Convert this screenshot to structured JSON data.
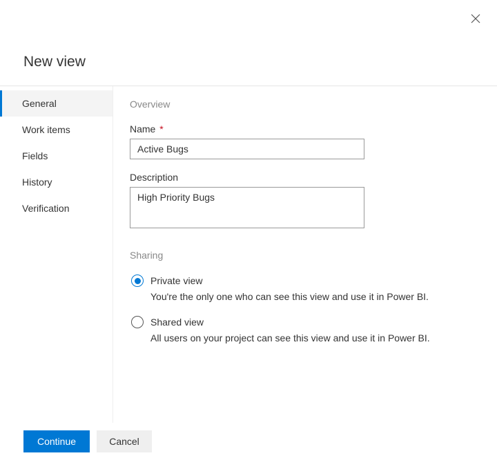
{
  "dialog": {
    "title": "New view"
  },
  "sidebar": {
    "items": [
      {
        "label": "General"
      },
      {
        "label": "Work items"
      },
      {
        "label": "Fields"
      },
      {
        "label": "History"
      },
      {
        "label": "Verification"
      }
    ]
  },
  "panel": {
    "overview_heading": "Overview",
    "name_label": "Name",
    "name_value": "Active Bugs",
    "description_label": "Description",
    "description_value": "High Priority Bugs",
    "sharing_heading": "Sharing",
    "private_label": "Private view",
    "private_desc": "You're the only one who can see this view and use it in Power BI.",
    "shared_label": "Shared view",
    "shared_desc": "All users on your project can see this view and use it in Power BI."
  },
  "footer": {
    "continue_label": "Continue",
    "cancel_label": "Cancel"
  }
}
